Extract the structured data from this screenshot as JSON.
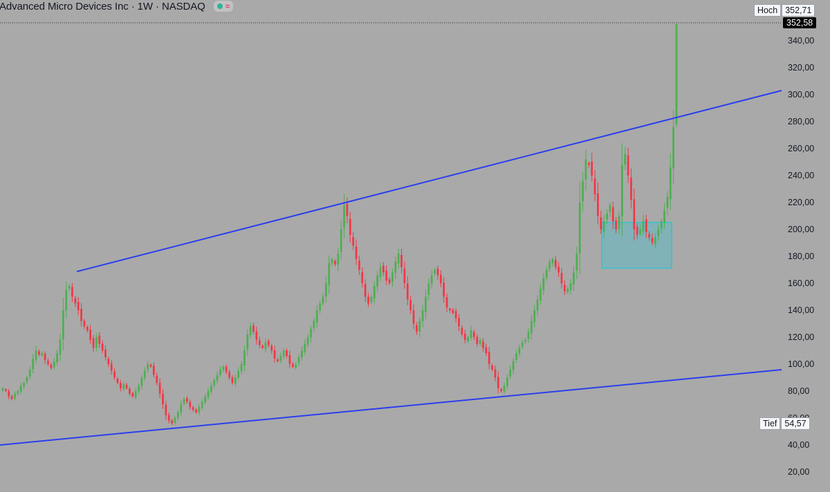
{
  "header": {
    "title": "Advanced Micro Devices Inc · 1W · NASDAQ",
    "status_dot_icon": "green-dot-icon",
    "status_wave_icon": "pink-wave-icon",
    "wave_glyph": "≈"
  },
  "markers": {
    "high_label": "Hoch",
    "high_value": "352,71",
    "last_price": "352,58",
    "low_label": "Tief",
    "low_value": "54,57"
  },
  "colors": {
    "background": "#a9a9a9",
    "up": "#4caf50",
    "down": "#f23645",
    "trendline": "#2a3ef0",
    "zone_fill": "#7fb3b8",
    "zone_border": "#2ec4d0",
    "axis_text": "#131722"
  },
  "chart_data": {
    "type": "candlestick",
    "title": "Advanced Micro Devices Inc · 1W · NASDAQ",
    "ylim": [
      5,
      357
    ],
    "grid": false,
    "y_tick_labels": [
      "20,00",
      "40,00",
      "60,00",
      "80,00",
      "100,00",
      "120,00",
      "140,00",
      "160,00",
      "180,00",
      "200,00",
      "220,00",
      "240,00",
      "260,00",
      "280,00",
      "300,00",
      "320,00",
      "340,00"
    ],
    "y_ticks": [
      20,
      40,
      60,
      80,
      100,
      120,
      140,
      160,
      180,
      200,
      220,
      240,
      260,
      280,
      300,
      320,
      340
    ],
    "high": 352.71,
    "low": 54.57,
    "last": 352.58,
    "closes": [
      82,
      80,
      76,
      74,
      78,
      80,
      84,
      86,
      90,
      96,
      104,
      110,
      107,
      108,
      103,
      100,
      97,
      102,
      108,
      118,
      140,
      155,
      158,
      150,
      145,
      140,
      132,
      128,
      125,
      118,
      112,
      120,
      115,
      110,
      105,
      100,
      95,
      90,
      86,
      82,
      85,
      82,
      78,
      76,
      80,
      84,
      90,
      95,
      100,
      98,
      92,
      86,
      78,
      70,
      62,
      58,
      56,
      60,
      64,
      70,
      74,
      72,
      68,
      66,
      64,
      68,
      72,
      76,
      80,
      84,
      88,
      92,
      96,
      98,
      94,
      90,
      86,
      90,
      95,
      100,
      110,
      122,
      128,
      124,
      118,
      114,
      112,
      116,
      114,
      110,
      104,
      102,
      106,
      110,
      106,
      100,
      98,
      100,
      105,
      110,
      115,
      120,
      126,
      132,
      140,
      145,
      150,
      160,
      175,
      178,
      174,
      182,
      200,
      218,
      210,
      196,
      188,
      178,
      170,
      160,
      150,
      145,
      150,
      158,
      166,
      172,
      168,
      162,
      160,
      168,
      176,
      182,
      172,
      160,
      148,
      140,
      130,
      124,
      132,
      140,
      150,
      160,
      166,
      170,
      166,
      160,
      150,
      142,
      140,
      138,
      134,
      128,
      122,
      118,
      120,
      125,
      120,
      115,
      118,
      112,
      108,
      100,
      96,
      90,
      82,
      80,
      84,
      90,
      96,
      102,
      108,
      112,
      116,
      118,
      124,
      132,
      140,
      148,
      156,
      164,
      170,
      176,
      178,
      172,
      168,
      160,
      154,
      156,
      160,
      168,
      182,
      220,
      236,
      252,
      248,
      240,
      226,
      210,
      200,
      206,
      212,
      218,
      206,
      200,
      210,
      248,
      256,
      240,
      222,
      200,
      196,
      200,
      206,
      198,
      194,
      190,
      194,
      200,
      206,
      214,
      224,
      246,
      276,
      352.58
    ]
  }
}
